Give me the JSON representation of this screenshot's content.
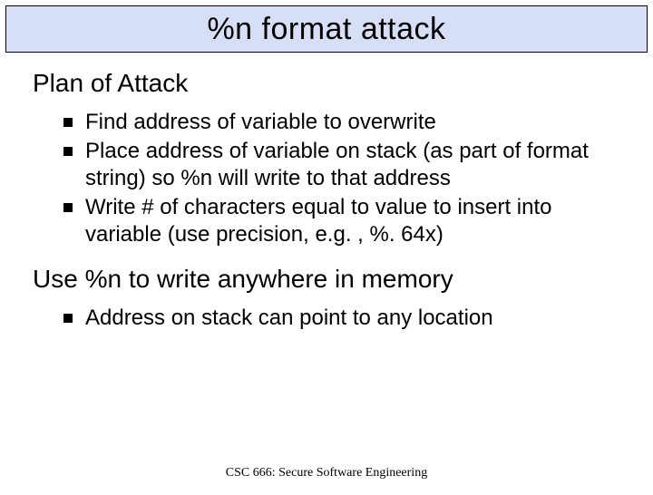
{
  "title": "%n format attack",
  "sections": [
    {
      "heading": "Plan of Attack",
      "bullets": [
        "Find address of variable to overwrite",
        "Place address of variable on stack (as part of format string) so %n will write to that address",
        "Write # of characters equal to value to insert into variable (use precision, e.g. , %. 64x)"
      ]
    },
    {
      "heading": "Use %n to write anywhere in memory",
      "bullets": [
        "Address on stack can point to any location"
      ]
    }
  ],
  "footer": "CSC 666: Secure Software Engineering"
}
